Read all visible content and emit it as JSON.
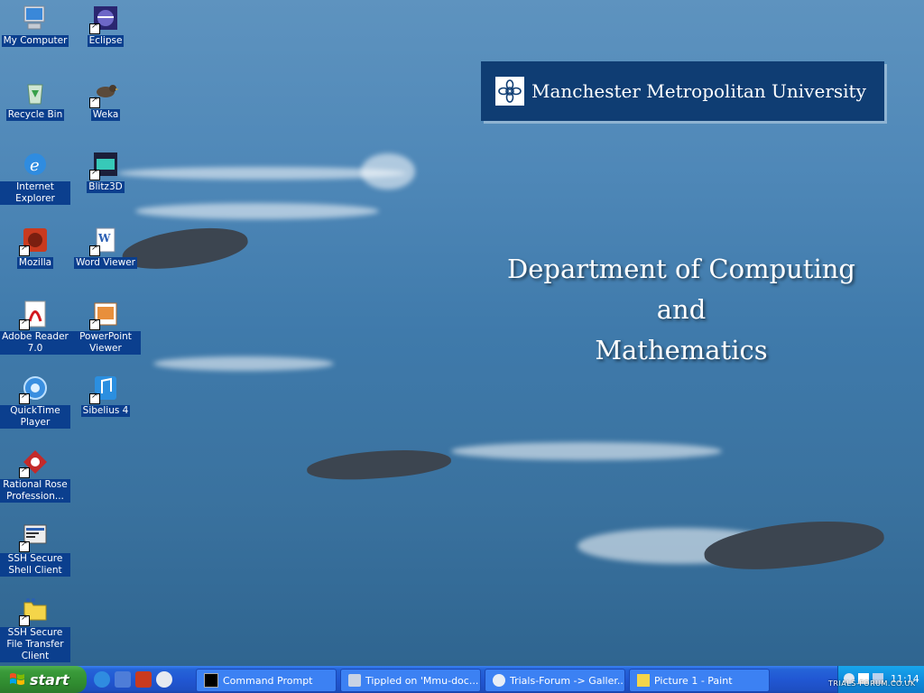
{
  "desktop": {
    "icons": [
      {
        "label": "My Computer"
      },
      {
        "label": "Eclipse"
      },
      {
        "label": "Recycle Bin"
      },
      {
        "label": "Weka"
      },
      {
        "label": "Internet Explorer"
      },
      {
        "label": "Blitz3D"
      },
      {
        "label": "Mozilla"
      },
      {
        "label": "Word Viewer"
      },
      {
        "label": "Adobe Reader 7.0"
      },
      {
        "label": "PowerPoint Viewer"
      },
      {
        "label": "QuickTime Player"
      },
      {
        "label": "Sibelius 4"
      },
      {
        "label": "Rational Rose Profession..."
      },
      {
        "label": "SSH Secure Shell Client"
      },
      {
        "label": "SSH Secure File Transfer Client"
      }
    ]
  },
  "wallpaper": {
    "university": "Manchester Metropolitan University",
    "department_lines": [
      "Department of Computing",
      "and",
      "Mathematics"
    ]
  },
  "taskbar": {
    "start_label": "start",
    "tasks": [
      {
        "label": "Command Prompt"
      },
      {
        "label": "Tippled on 'Mmu-doc..."
      },
      {
        "label": "Trials-Forum -> Galler..."
      },
      {
        "label": "Picture 1 - Paint"
      }
    ],
    "clock": "11:14"
  },
  "watermark": "TRIALS-FORUM.CO.UK",
  "colors": {
    "taskbar": "#2157d3",
    "start": "#3a9b3a",
    "banner": "#0f3d73",
    "icon_label_bg": "#0b3f8e"
  }
}
